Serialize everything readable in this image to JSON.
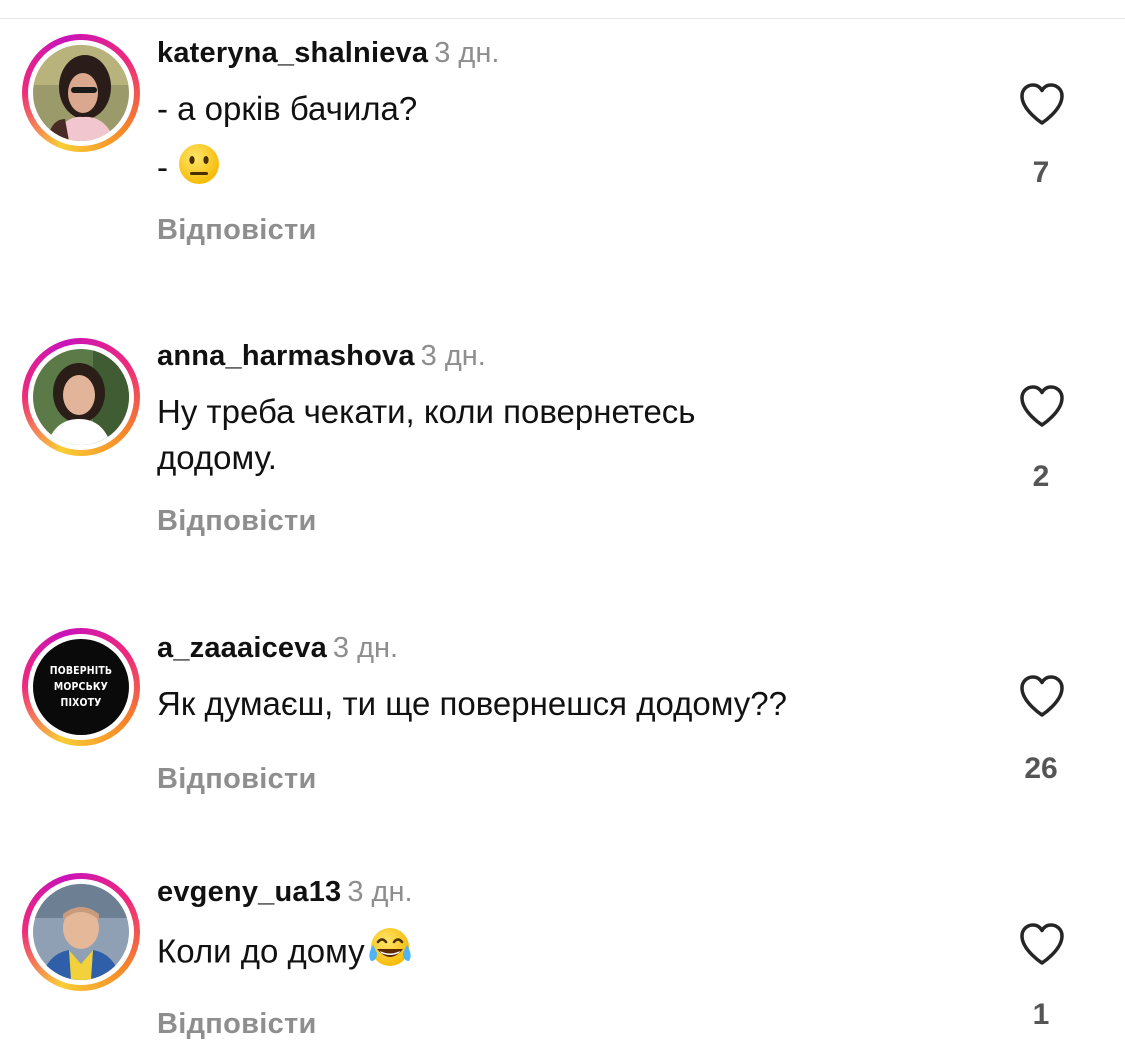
{
  "comments": [
    {
      "username": "kateryna_shalnieva",
      "time": "3 дн.",
      "line1": "- а орків бачила?",
      "line2": "- ",
      "emoji": "neutral-face-emoji",
      "likes": "7",
      "reply": "Відповісти"
    },
    {
      "username": "anna_harmashova",
      "time": "3 дн.",
      "line1": "Ну треба чекати, коли повернетесь",
      "line2": "додому.",
      "likes": "2",
      "reply": "Відповісти"
    },
    {
      "username": "a_zaaaiceva",
      "time": "3 дн.",
      "line1": "Як думаєш, ти ще повернешся додому??",
      "avatar_text": [
        "ПОВЕРНІТЬ",
        "МОРСЬКУ",
        "ПІХОТУ"
      ],
      "likes": "26",
      "reply": "Відповісти"
    },
    {
      "username": "evgeny_ua13",
      "time": "3 дн.",
      "line1": "Коли до дому",
      "emoji": "tears-of-joy-emoji",
      "likes": "1",
      "reply": "Відповісти"
    }
  ],
  "colors": {
    "secondary_text": "#8e8e8e",
    "primary_text": "#111111",
    "heart_stroke": "#262626"
  }
}
